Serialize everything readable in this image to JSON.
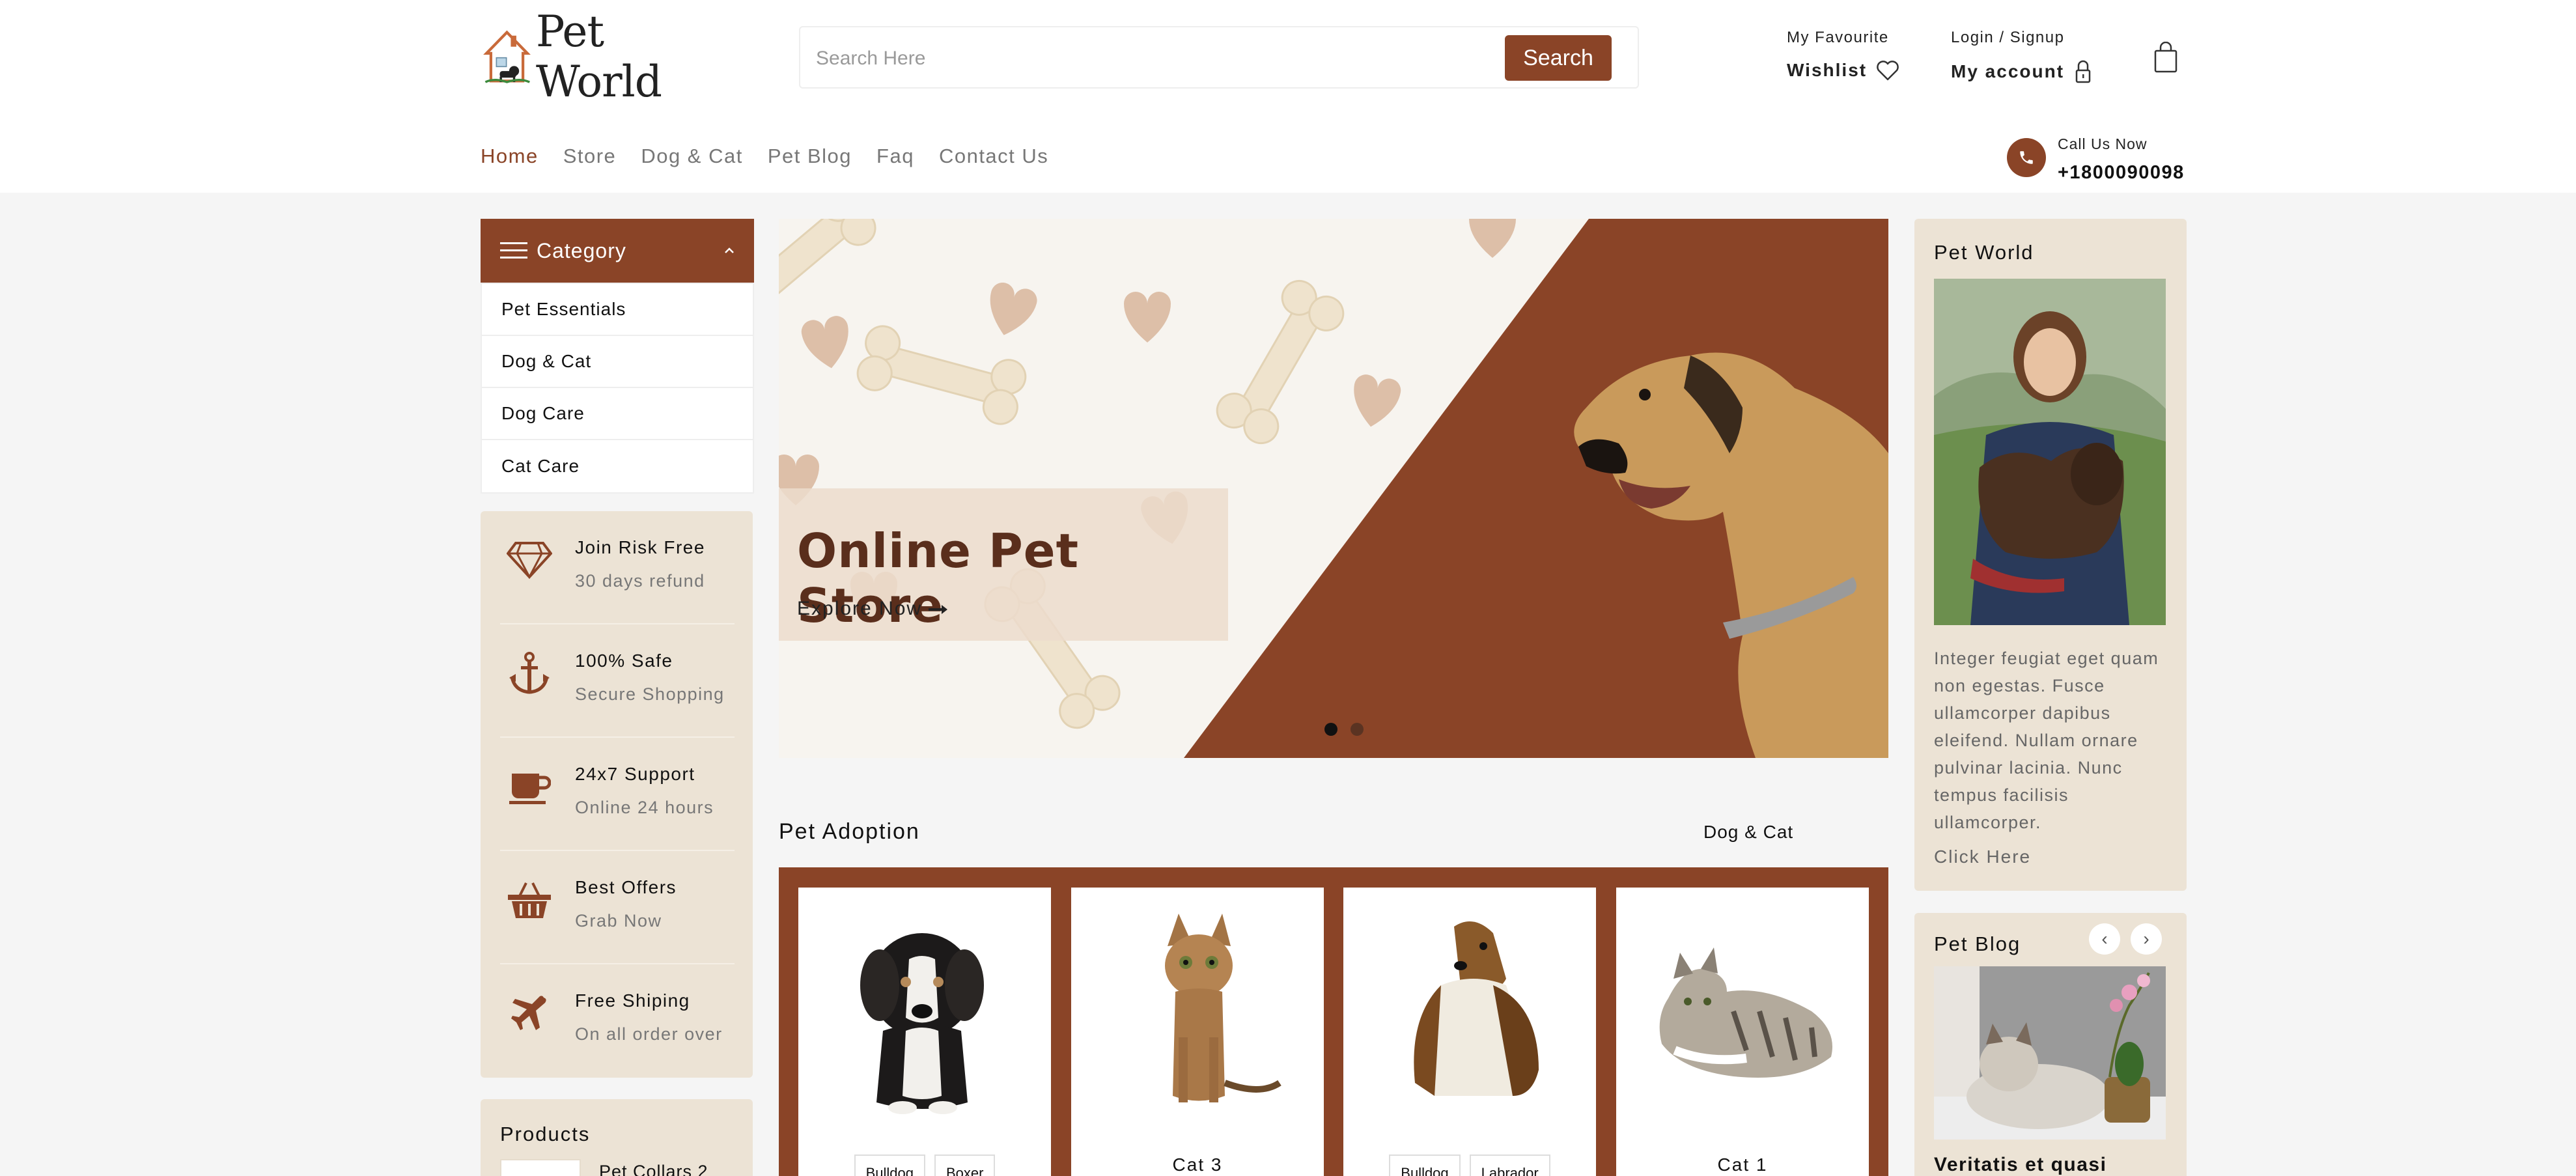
{
  "header": {
    "logo_text": "Pet World",
    "search": {
      "placeholder": "Search Here",
      "button_label": "Search"
    },
    "wishlist": {
      "top_label": "My Favourite",
      "label": "Wishlist"
    },
    "account": {
      "top_label": "Login / Signup",
      "label": "My account"
    }
  },
  "nav": {
    "items": [
      "Home",
      "Store",
      "Dog & Cat",
      "Pet Blog",
      "Faq",
      "Contact Us"
    ],
    "active": "Home"
  },
  "contact": {
    "label": "Call Us Now",
    "phone": "+1800090098"
  },
  "sidebar": {
    "category_title": "Category",
    "categories": [
      "Pet Essentials",
      "Dog & Cat",
      "Dog Care",
      "Cat Care"
    ],
    "features": [
      {
        "icon": "diamond-icon",
        "title": "Join Risk Free",
        "subtitle": "30 days refund"
      },
      {
        "icon": "anchor-icon",
        "title": "100% Safe",
        "subtitle": "Secure Shopping"
      },
      {
        "icon": "coffee-cup-icon",
        "title": "24x7 Support",
        "subtitle": "Online 24 hours"
      },
      {
        "icon": "basket-icon",
        "title": "Best Offers",
        "subtitle": "Grab Now"
      },
      {
        "icon": "airplane-icon",
        "title": "Free Shiping",
        "subtitle": "On all order over"
      }
    ],
    "products": {
      "title": "Products",
      "first_item": "Pet Collars 2"
    }
  },
  "banner": {
    "title": "Online Pet Store",
    "link": "Explore Now",
    "slides": 2,
    "active_slide": 1
  },
  "adoption": {
    "title": "Pet Adoption",
    "tab": "Dog & Cat",
    "cards": [
      {
        "tags": [
          "Bulldog",
          "Boxer"
        ]
      },
      {
        "name": "Cat 3"
      },
      {
        "tags": [
          "Bulldog",
          "Labrador"
        ]
      },
      {
        "name": "Cat 1"
      }
    ]
  },
  "right": {
    "pet_world": {
      "title": "Pet World",
      "text": "Integer feugiat eget quam non egestas. Fusce ullamcorper dapibus eleifend. Nullam ornare pulvinar lacinia. Nunc tempus facilisis ullamcorper.",
      "link": "Click Here"
    },
    "blog": {
      "title": "Pet Blog",
      "post_title": "Veritatis et quasi"
    }
  },
  "colors": {
    "accent": "#8a4427",
    "panel": "#ece3d5",
    "background": "#f5f5f5"
  }
}
